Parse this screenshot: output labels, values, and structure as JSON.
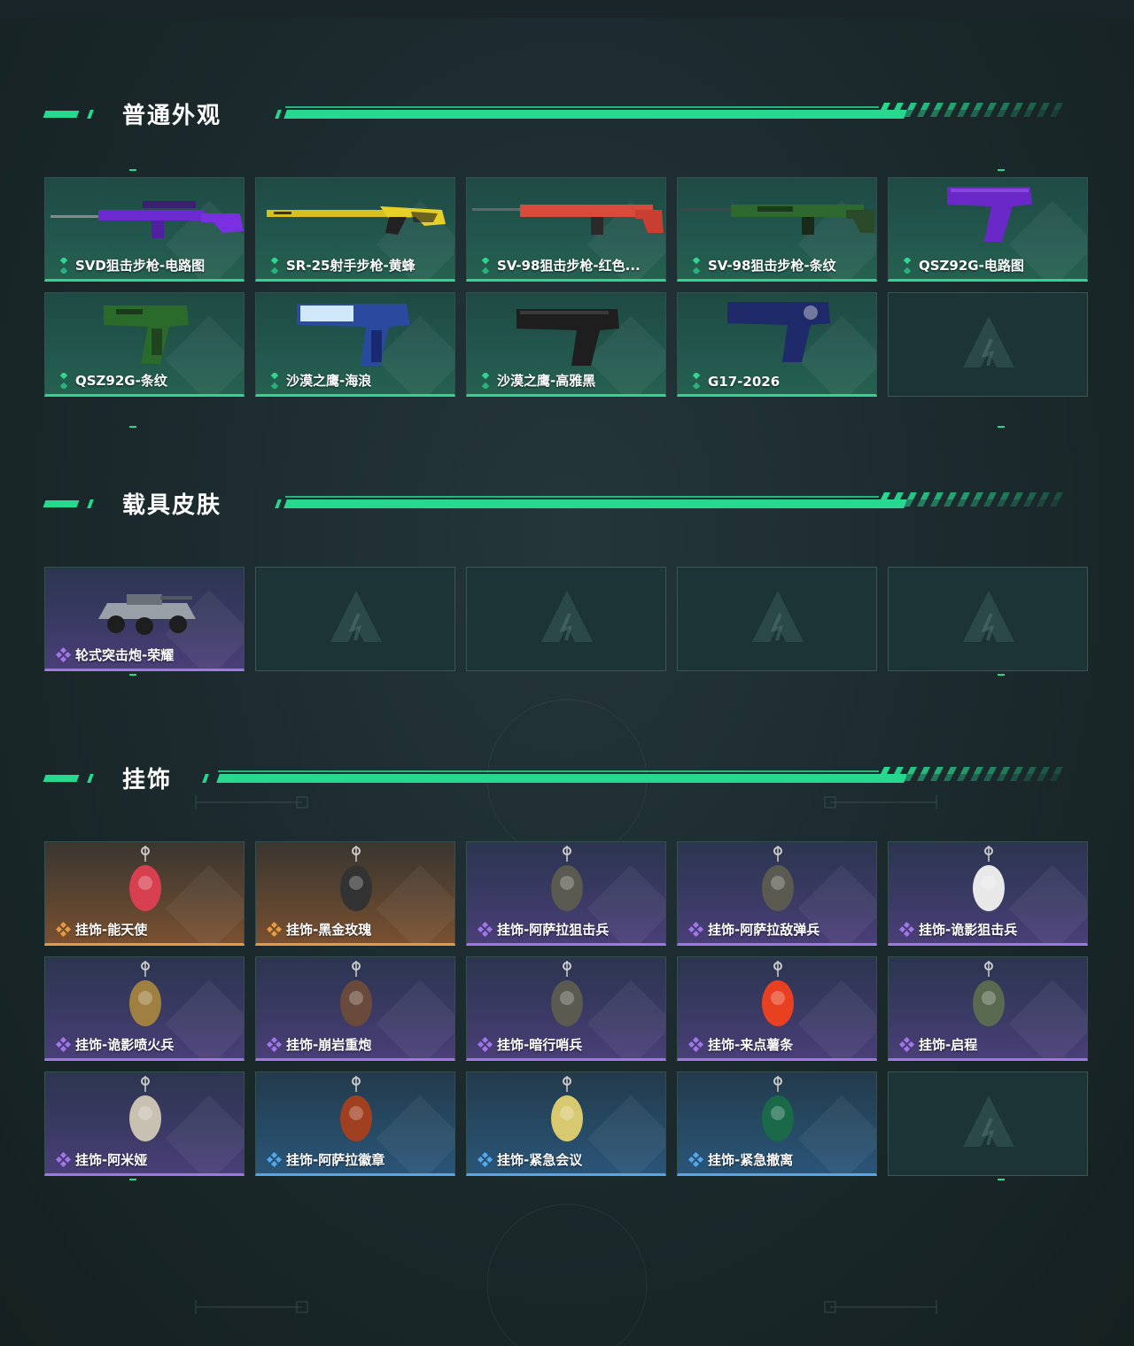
{
  "sections": {
    "weapons": {
      "title": "普通外观",
      "items": [
        {
          "label": "SVD狙击步枪-电路图",
          "rarity": "green",
          "art": "sniper-rifle-purple"
        },
        {
          "label": "SR-25射手步枪-黄蜂",
          "rarity": "green",
          "art": "rifle-yellow"
        },
        {
          "label": "SV-98狙击步枪-红色...",
          "rarity": "green",
          "art": "sniper-rifle-red"
        },
        {
          "label": "SV-98狙击步枪-条纹",
          "rarity": "green",
          "art": "sniper-rifle-camo"
        },
        {
          "label": "QSZ92G-电路图",
          "rarity": "green",
          "art": "pistol-purple"
        },
        {
          "label": "QSZ92G-条纹",
          "rarity": "green",
          "art": "pistol-camo"
        },
        {
          "label": "沙漠之鹰-海浪",
          "rarity": "green",
          "art": "deagle-blue"
        },
        {
          "label": "沙漠之鹰-高雅黑",
          "rarity": "green",
          "art": "deagle-black"
        },
        {
          "label": "G17-2026",
          "rarity": "green",
          "art": "pistol-navy"
        }
      ]
    },
    "vehicles": {
      "title": "载具皮肤",
      "items": [
        {
          "label": "轮式突击炮-荣耀",
          "rarity": "purple",
          "art": "armored-vehicle"
        }
      ]
    },
    "charms": {
      "title": "挂饰",
      "items": [
        {
          "label": "挂饰-能天使",
          "rarity": "orange",
          "art": "charm-card"
        },
        {
          "label": "挂饰-黑金玫瑰",
          "rarity": "orange",
          "art": "charm-rose"
        },
        {
          "label": "挂饰-阿萨拉狙击兵",
          "rarity": "purple",
          "art": "charm-soldier"
        },
        {
          "label": "挂饰-阿萨拉敌弹兵",
          "rarity": "purple",
          "art": "charm-soldier"
        },
        {
          "label": "挂饰-诡影狙击兵",
          "rarity": "purple",
          "art": "charm-bird"
        },
        {
          "label": "挂饰-诡影喷火兵",
          "rarity": "purple",
          "art": "charm-robot"
        },
        {
          "label": "挂饰-崩岩重炮",
          "rarity": "purple",
          "art": "charm-creature"
        },
        {
          "label": "挂饰-暗行哨兵",
          "rarity": "purple",
          "art": "charm-soldier"
        },
        {
          "label": "挂饰-来点薯条",
          "rarity": "purple",
          "art": "charm-fries"
        },
        {
          "label": "挂饰-启程",
          "rarity": "purple",
          "art": "charm-badge"
        },
        {
          "label": "挂饰-阿米娅",
          "rarity": "purple",
          "art": "charm-bunny"
        },
        {
          "label": "挂饰-阿萨拉徽章",
          "rarity": "blue",
          "art": "charm-medal"
        },
        {
          "label": "挂饰-紧急会议",
          "rarity": "blue",
          "art": "charm-sticker"
        },
        {
          "label": "挂饰-紧急撤离",
          "rarity": "blue",
          "art": "charm-box"
        }
      ]
    }
  },
  "colors": {
    "accent": "#27d98f",
    "green": "#2fd690",
    "purple": "#a078e6",
    "orange": "#e59a48",
    "blue": "#58a6e8"
  }
}
